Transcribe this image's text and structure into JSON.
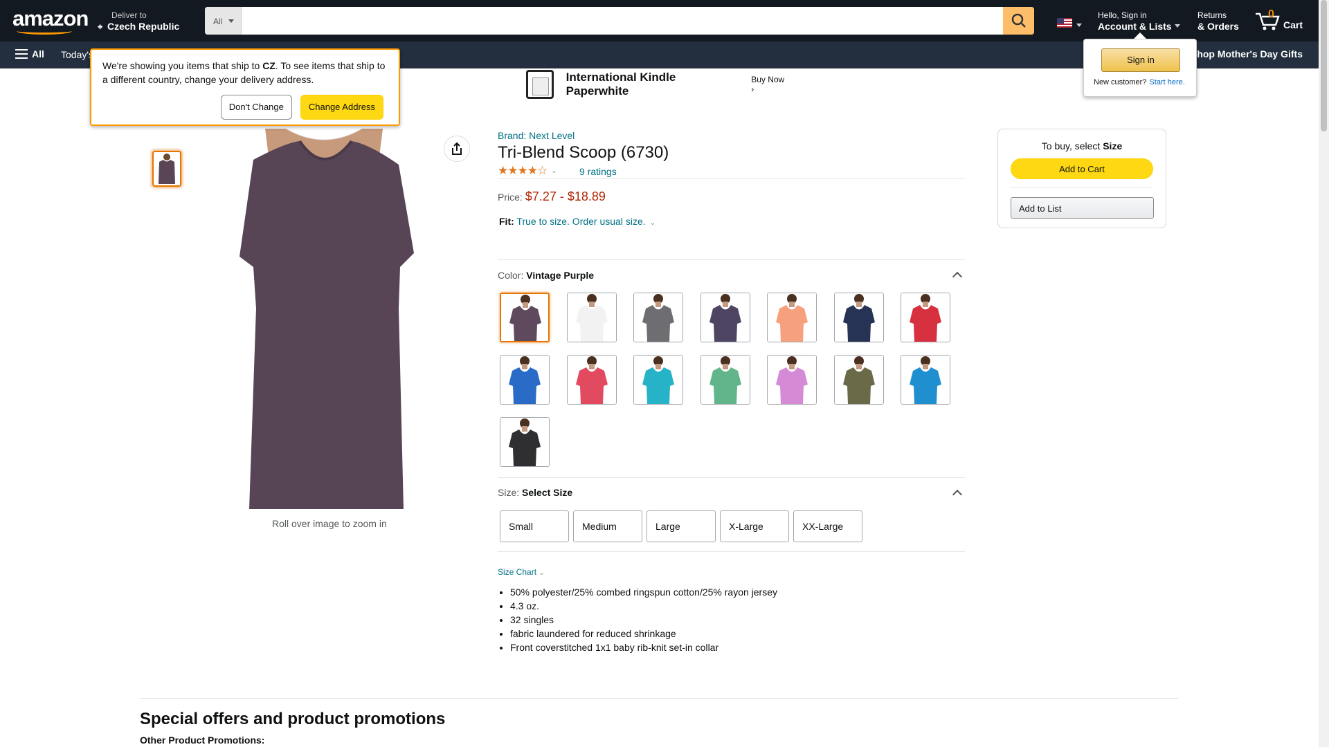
{
  "nav": {
    "logo": "amazon",
    "deliver_line1": "Deliver to",
    "deliver_line2": "Czech Republic",
    "search_category": "All",
    "search_placeholder": "",
    "account_line1": "Hello, Sign in",
    "account_line2": "Account & Lists",
    "returns_line1": "Returns",
    "returns_line2": "& Orders",
    "cart_count": "0",
    "cart_label": "Cart"
  },
  "subnav": {
    "all_label": "All",
    "todays_label": "Today's",
    "promo_label": "Shop Mother's Day Gifts"
  },
  "ship_popover": {
    "text_pre": "We're showing you items that ship to ",
    "country": "CZ",
    "text_post": ". To see items that ship to a different country, change your delivery address.",
    "dont_change": "Don't Change",
    "change_address": "Change Address"
  },
  "signin_flyout": {
    "button": "Sign in",
    "new_customer": "New customer?",
    "start_here": "Start here."
  },
  "banner": {
    "title": "International Kindle Paperwhite",
    "cta": "Buy Now ›"
  },
  "gallery": {
    "zoom_hint": "Roll over image to zoom in"
  },
  "product": {
    "brand": "Brand: Next Level",
    "title": "Tri-Blend Scoop (6730)",
    "rating_value": 4.5,
    "ratings_count": "9 ratings",
    "price_label": "Price:",
    "price_value": "$7.27 - $18.89",
    "fit_label": "Fit:",
    "fit_value": "True to size. Order usual size.",
    "color_label": "Color: ",
    "color_selected": "Vintage Purple",
    "size_label": "Size: ",
    "size_selected": "Select Size",
    "size_chart": "Size Chart",
    "sizes": [
      "Small",
      "Medium",
      "Large",
      "X-Large",
      "XX-Large"
    ],
    "bullets": [
      "50% polyester/25% combed ringspun cotton/25% rayon jersey",
      "4.3 oz.",
      "32 singles",
      "fabric laundered for reduced shrinkage",
      "Front coverstitched 1x1 baby rib-knit set-in collar"
    ],
    "swatch_colors": [
      "#5e4a5c",
      "#f2f2f2",
      "#6e6e72",
      "#4e4563",
      "#f7a07e",
      "#263354",
      "#d7303e",
      "#2a6bc7",
      "#e24a5f",
      "#27b3c7",
      "#62b58a",
      "#d58ad6",
      "#6b6a48",
      "#1f8fd0",
      "#2f2f31"
    ]
  },
  "buybox": {
    "select_pre": "To buy, select ",
    "select_bold": "Size",
    "add_to_cart": "Add to Cart",
    "add_to_list": "Add to List"
  },
  "bottom": {
    "special_offers": "Special offers and product promotions",
    "other_promotions": "Other Product Promotions:"
  },
  "colors": {
    "nav_bg": "#131921",
    "subnav_bg": "#232f3e",
    "accent": "#ff9900",
    "link": "#007185",
    "price": "#b12704"
  }
}
